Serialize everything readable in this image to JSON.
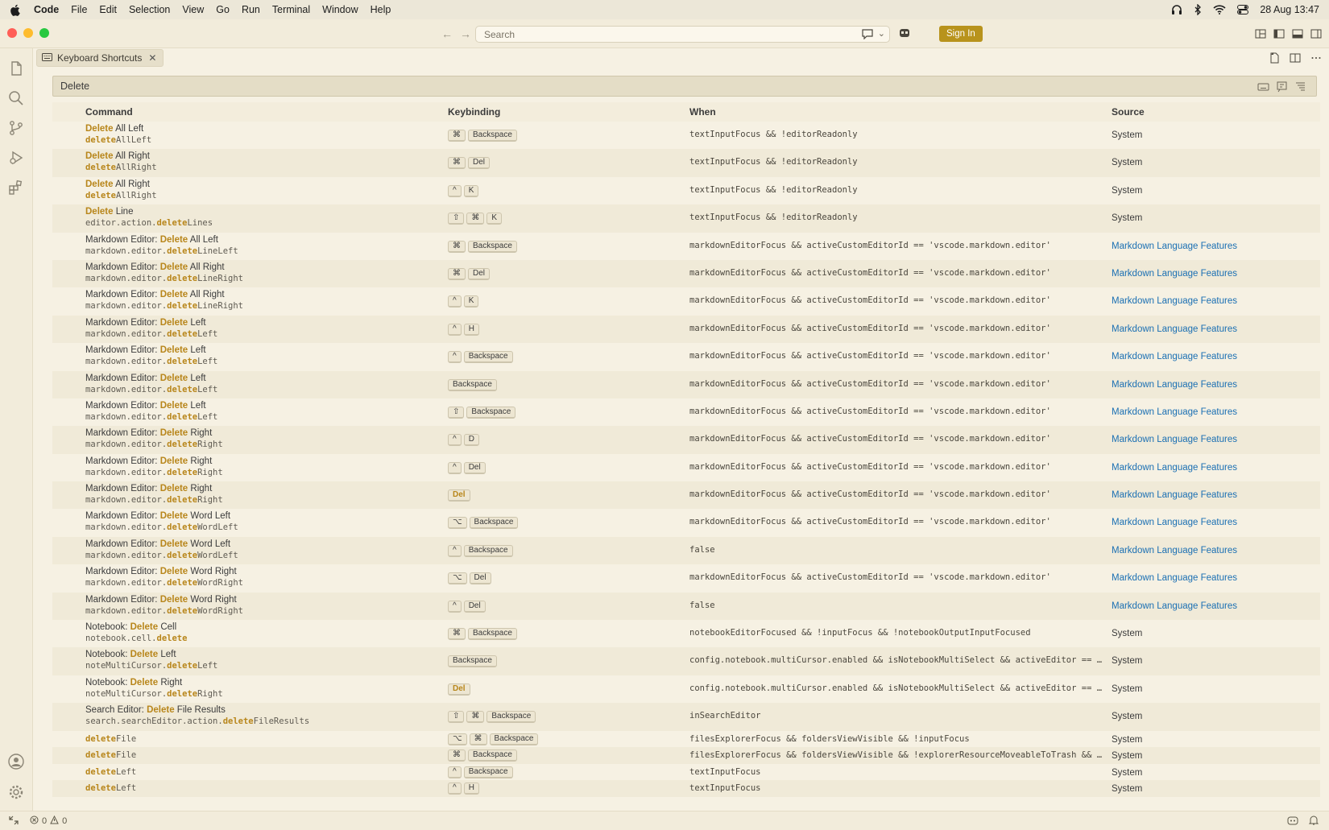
{
  "menubar": {
    "app": "Code",
    "items": [
      "File",
      "Edit",
      "Selection",
      "View",
      "Go",
      "Run",
      "Terminal",
      "Window",
      "Help"
    ],
    "datetime": "28 Aug  13:47"
  },
  "titlebar": {
    "search_placeholder": "Search",
    "sign_in": "Sign In"
  },
  "tab": {
    "label": "Keyboard Shortcuts"
  },
  "search": {
    "value": "Delete"
  },
  "table": {
    "headers": {
      "command": "Command",
      "keybinding": "Keybinding",
      "when": "When",
      "source": "Source"
    },
    "rows": [
      {
        "label": [
          "",
          "Delete",
          " All Left"
        ],
        "id": [
          "",
          "delete",
          "AllLeft"
        ],
        "keys": [
          "⌘",
          "Backspace"
        ],
        "when": "textInputFocus && !editorReadonly",
        "source": "System"
      },
      {
        "label": [
          "",
          "Delete",
          " All Right"
        ],
        "id": [
          "",
          "delete",
          "AllRight"
        ],
        "keys": [
          "⌘",
          "Del"
        ],
        "when": "textInputFocus && !editorReadonly",
        "source": "System"
      },
      {
        "label": [
          "",
          "Delete",
          " All Right"
        ],
        "id": [
          "",
          "delete",
          "AllRight"
        ],
        "keys": [
          "^",
          "K"
        ],
        "when": "textInputFocus && !editorReadonly",
        "source": "System"
      },
      {
        "label": [
          "",
          "Delete",
          " Line"
        ],
        "id": [
          "editor.action.",
          "delete",
          "Lines"
        ],
        "keys": [
          "⇧",
          "⌘",
          "K"
        ],
        "when": "textInputFocus && !editorReadonly",
        "source": "System"
      },
      {
        "label": [
          "Markdown Editor: ",
          "Delete",
          " All Left"
        ],
        "id": [
          "markdown.editor.",
          "delete",
          "LineLeft"
        ],
        "keys": [
          "⌘",
          "Backspace"
        ],
        "when": "markdownEditorFocus && activeCustomEditorId == 'vscode.markdown.editor'",
        "source": "Markdown Language Features"
      },
      {
        "label": [
          "Markdown Editor: ",
          "Delete",
          " All Right"
        ],
        "id": [
          "markdown.editor.",
          "delete",
          "LineRight"
        ],
        "keys": [
          "⌘",
          "Del"
        ],
        "when": "markdownEditorFocus && activeCustomEditorId == 'vscode.markdown.editor'",
        "source": "Markdown Language Features"
      },
      {
        "label": [
          "Markdown Editor: ",
          "Delete",
          " All Right"
        ],
        "id": [
          "markdown.editor.",
          "delete",
          "LineRight"
        ],
        "keys": [
          "^",
          "K"
        ],
        "when": "markdownEditorFocus && activeCustomEditorId == 'vscode.markdown.editor'",
        "source": "Markdown Language Features"
      },
      {
        "label": [
          "Markdown Editor: ",
          "Delete",
          " Left"
        ],
        "id": [
          "markdown.editor.",
          "delete",
          "Left"
        ],
        "keys": [
          "^",
          "H"
        ],
        "when": "markdownEditorFocus && activeCustomEditorId == 'vscode.markdown.editor'",
        "source": "Markdown Language Features"
      },
      {
        "label": [
          "Markdown Editor: ",
          "Delete",
          " Left"
        ],
        "id": [
          "markdown.editor.",
          "delete",
          "Left"
        ],
        "keys": [
          "^",
          "Backspace"
        ],
        "when": "markdownEditorFocus && activeCustomEditorId == 'vscode.markdown.editor'",
        "source": "Markdown Language Features"
      },
      {
        "label": [
          "Markdown Editor: ",
          "Delete",
          " Left"
        ],
        "id": [
          "markdown.editor.",
          "delete",
          "Left"
        ],
        "keys": [
          "Backspace"
        ],
        "when": "markdownEditorFocus && activeCustomEditorId == 'vscode.markdown.editor'",
        "source": "Markdown Language Features"
      },
      {
        "label": [
          "Markdown Editor: ",
          "Delete",
          " Left"
        ],
        "id": [
          "markdown.editor.",
          "delete",
          "Left"
        ],
        "keys": [
          "⇧",
          "Backspace"
        ],
        "when": "markdownEditorFocus && activeCustomEditorId == 'vscode.markdown.editor'",
        "source": "Markdown Language Features"
      },
      {
        "label": [
          "Markdown Editor: ",
          "Delete",
          " Right"
        ],
        "id": [
          "markdown.editor.",
          "delete",
          "Right"
        ],
        "keys": [
          "^",
          "D"
        ],
        "when": "markdownEditorFocus && activeCustomEditorId == 'vscode.markdown.editor'",
        "source": "Markdown Language Features"
      },
      {
        "label": [
          "Markdown Editor: ",
          "Delete",
          " Right"
        ],
        "id": [
          "markdown.editor.",
          "delete",
          "Right"
        ],
        "keys": [
          "^",
          "Del"
        ],
        "when": "markdownEditorFocus && activeCustomEditorId == 'vscode.markdown.editor'",
        "source": "Markdown Language Features"
      },
      {
        "label": [
          "Markdown Editor: ",
          "Delete",
          " Right"
        ],
        "id": [
          "markdown.editor.",
          "delete",
          "Right"
        ],
        "keys": [
          "Del"
        ],
        "hl_key": true,
        "when": "markdownEditorFocus && activeCustomEditorId == 'vscode.markdown.editor'",
        "source": "Markdown Language Features"
      },
      {
        "label": [
          "Markdown Editor: ",
          "Delete",
          " Word Left"
        ],
        "id": [
          "markdown.editor.",
          "delete",
          "WordLeft"
        ],
        "keys": [
          "⌥",
          "Backspace"
        ],
        "when": "markdownEditorFocus && activeCustomEditorId == 'vscode.markdown.editor'",
        "source": "Markdown Language Features"
      },
      {
        "label": [
          "Markdown Editor: ",
          "Delete",
          " Word Left"
        ],
        "id": [
          "markdown.editor.",
          "delete",
          "WordLeft"
        ],
        "keys": [
          "^",
          "Backspace"
        ],
        "when": "false",
        "source": "Markdown Language Features"
      },
      {
        "label": [
          "Markdown Editor: ",
          "Delete",
          " Word Right"
        ],
        "id": [
          "markdown.editor.",
          "delete",
          "WordRight"
        ],
        "keys": [
          "⌥",
          "Del"
        ],
        "when": "markdownEditorFocus && activeCustomEditorId == 'vscode.markdown.editor'",
        "source": "Markdown Language Features"
      },
      {
        "label": [
          "Markdown Editor: ",
          "Delete",
          " Word Right"
        ],
        "id": [
          "markdown.editor.",
          "delete",
          "WordRight"
        ],
        "keys": [
          "^",
          "Del"
        ],
        "when": "false",
        "source": "Markdown Language Features"
      },
      {
        "label": [
          "Notebook: ",
          "Delete",
          " Cell"
        ],
        "id": [
          "notebook.cell.",
          "delete",
          ""
        ],
        "keys": [
          "⌘",
          "Backspace"
        ],
        "when": "notebookEditorFocused && !inputFocus && !notebookOutputInputFocused",
        "source": "System"
      },
      {
        "label": [
          "Notebook: ",
          "Delete",
          " Left"
        ],
        "id": [
          "noteMultiCursor.",
          "delete",
          "Left"
        ],
        "keys": [
          "Backspace"
        ],
        "when": "config.notebook.multiCursor.enabled && isNotebookMultiSelect && activeEditor == 'workbench.editor.notebook'",
        "source": "System"
      },
      {
        "label": [
          "Notebook: ",
          "Delete",
          " Right"
        ],
        "id": [
          "noteMultiCursor.",
          "delete",
          "Right"
        ],
        "keys": [
          "Del"
        ],
        "hl_key": true,
        "when": "config.notebook.multiCursor.enabled && isNotebookMultiSelect && activeEditor == 'workbench.editor.notebook'",
        "source": "System"
      },
      {
        "label": [
          "Search Editor: ",
          "Delete",
          " File Results"
        ],
        "id": [
          "search.searchEditor.action.",
          "delete",
          "FileResults"
        ],
        "keys": [
          "⇧",
          "⌘",
          "Backspace"
        ],
        "when": "inSearchEditor",
        "source": "System"
      },
      {
        "single": true,
        "id": [
          "",
          "delete",
          "File"
        ],
        "keys": [
          "⌥",
          "⌘",
          "Backspace"
        ],
        "when": "filesExplorerFocus && foldersViewVisible && !inputFocus",
        "source": "System"
      },
      {
        "single": true,
        "id": [
          "",
          "delete",
          "File"
        ],
        "keys": [
          "⌘",
          "Backspace"
        ],
        "when": "filesExplorerFocus && foldersViewVisible && !explorerResourceMoveableToTrash && !inputFocus",
        "source": "System"
      },
      {
        "single": true,
        "id": [
          "",
          "delete",
          "Left"
        ],
        "keys": [
          "^",
          "Backspace"
        ],
        "when": "textInputFocus",
        "source": "System"
      },
      {
        "single": true,
        "id": [
          "",
          "delete",
          "Left"
        ],
        "keys": [
          "^",
          "H"
        ],
        "when": "textInputFocus",
        "source": "System"
      }
    ]
  },
  "statusbar": {
    "errors": "0",
    "warnings": "0"
  },
  "colors": {
    "accent": "#b8931c",
    "highlight": "#b8861b",
    "link": "#1a6fb3",
    "background": "#f6f1e3"
  }
}
